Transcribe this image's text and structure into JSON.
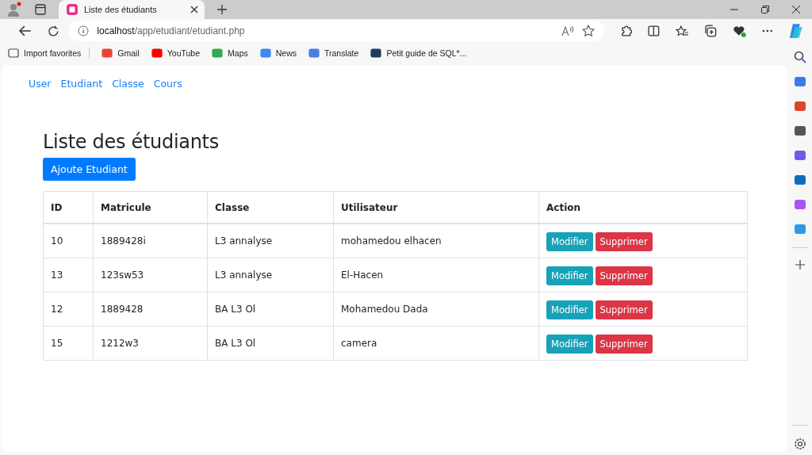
{
  "browser": {
    "tab_title": "Liste des étudiants",
    "url_host": "localhost",
    "url_path": "/app/etudiant/etudiant.php",
    "bookmarks": [
      "Import favorites",
      "Gmail",
      "YouTube",
      "Maps",
      "News",
      "Translate",
      "Petit guide de SQL*..."
    ]
  },
  "nav": [
    "User",
    "Etudiant",
    "Classe",
    "Cours"
  ],
  "heading": "Liste des étudiants",
  "add_button": "Ajoute Etudiant",
  "table": {
    "columns": [
      "ID",
      "Matricule",
      "Classe",
      "Utilisateur",
      "Action"
    ],
    "rows": [
      {
        "id": "10",
        "matricule": "1889428i",
        "classe": "L3 annalyse",
        "utilisateur": "mohamedou elhacen",
        "actions": [
          "Modifier",
          "Supprimer"
        ]
      },
      {
        "id": "13",
        "matricule": "123sw53",
        "classe": "L3 annalyse",
        "utilisateur": "El-Hacen",
        "actions": [
          "Modifier",
          "Supprimer"
        ]
      },
      {
        "id": "12",
        "matricule": "1889428",
        "classe": "BA L3 Ol",
        "utilisateur": "Mohamedou Dada",
        "actions": [
          "Modifier",
          "Supprimer"
        ]
      },
      {
        "id": "15",
        "matricule": "1212w3",
        "classe": "BA L3 Ol",
        "utilisateur": "camera",
        "actions": [
          "Modifier",
          "Supprimer"
        ]
      }
    ]
  }
}
